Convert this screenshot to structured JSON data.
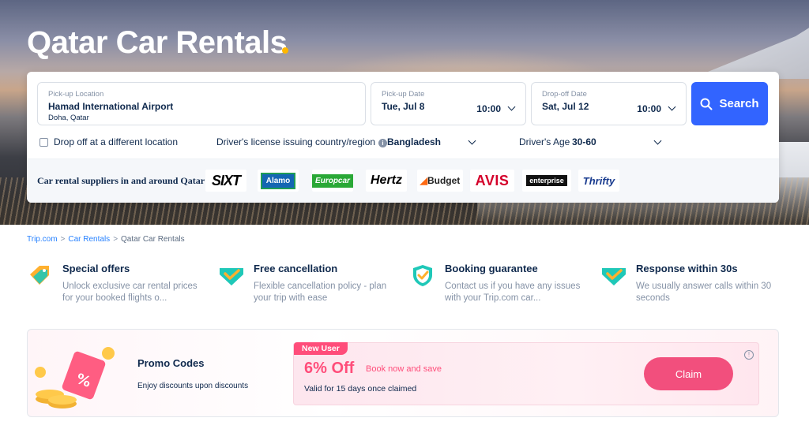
{
  "page": {
    "title": "Qatar Car Rentals"
  },
  "search": {
    "pickup_location_label": "Pick-up Location",
    "pickup_location_value": "Hamad International Airport",
    "pickup_location_sub": "Doha, Qatar",
    "pickup_date_label": "Pick-up Date",
    "pickup_date_value": "Tue, Jul 8",
    "pickup_time": "10:00",
    "dropoff_date_label": "Drop-off Date",
    "dropoff_date_value": "Sat, Jul 12",
    "dropoff_time": "10:00",
    "search_label": "Search"
  },
  "options": {
    "different_dropoff_label": "Drop off at a different location",
    "different_dropoff_checked": false,
    "license_label": "Driver's license issuing country/region",
    "license_value": "Bangladesh",
    "age_label": "Driver's Age",
    "age_value": "30-60"
  },
  "suppliers": {
    "label": "Car rental suppliers in and around Qatar",
    "logos": [
      "SIXT",
      "Alamo",
      "Europcar",
      "Hertz",
      "Budget",
      "AVIS",
      "enterprise",
      "Thrifty"
    ]
  },
  "breadcrumb": {
    "items": [
      "Trip.com",
      "Car Rentals",
      "Qatar Car Rentals"
    ],
    "separator": ">"
  },
  "features": [
    {
      "title": "Special offers",
      "desc": "Unlock exclusive car rental prices for your booked flights o...",
      "icon": "tag-icon"
    },
    {
      "title": "Free cancellation",
      "desc": "Flexible cancellation policy - plan your trip with ease",
      "icon": "check-badge-icon"
    },
    {
      "title": "Booking guarantee",
      "desc": "Contact us if you have any issues with your Trip.com car...",
      "icon": "shield-check-icon"
    },
    {
      "title": "Response within 30s",
      "desc": "We usually answer calls within 30 seconds",
      "icon": "check-badge-icon"
    }
  ],
  "promo": {
    "title": "Promo Codes",
    "subtitle": "Enjoy discounts upon discounts",
    "badge": "New User",
    "discount": "6% Off",
    "discount_sub": "Book now and save",
    "validity": "Valid for 15 days once claimed",
    "claim_label": "Claim"
  },
  "colors": {
    "accent": "#3264ff",
    "promo_pink": "#ff4d7a",
    "text": "#0f294d",
    "muted": "#8592a6",
    "link": "#2681ff"
  }
}
